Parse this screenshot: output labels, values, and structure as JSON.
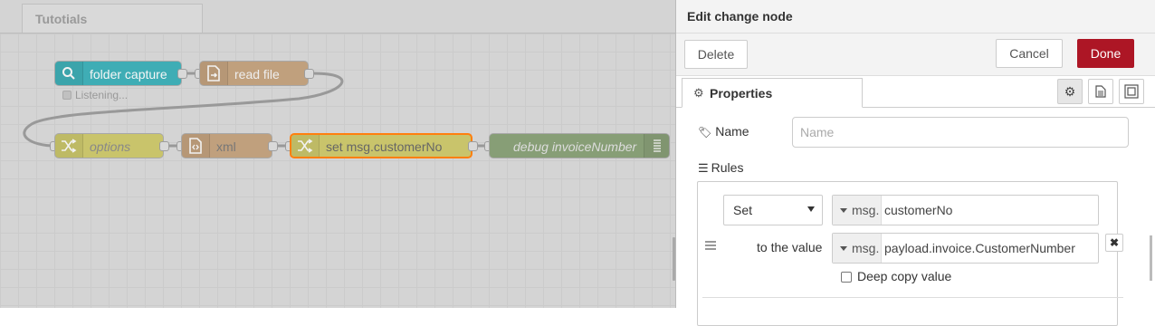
{
  "workspace": {
    "tab_label": "Tutotials",
    "nodes": [
      {
        "label": "folder capture",
        "icon": "search-icon",
        "color": "#3FADB5"
      },
      {
        "label": "read file",
        "icon": "file-in-icon",
        "color": "#C0A07D"
      },
      {
        "label": "options",
        "icon": "shuffle-icon",
        "color": "#C9C46B"
      },
      {
        "label": "xml",
        "icon": "file-code-icon",
        "color": "#C0A07D"
      },
      {
        "label": "set msg.customerNo",
        "icon": "shuffle-icon",
        "color": "#C9C46B"
      },
      {
        "label": "debug invoiceNumber",
        "icon": "list-icon",
        "color": "#879E76"
      }
    ],
    "status_text": "Listening..."
  },
  "tray": {
    "title": "Edit change node",
    "delete_label": "Delete",
    "cancel_label": "Cancel",
    "done_label": "Done",
    "properties_tab": "Properties",
    "name_label": "Name",
    "name_placeholder": "Name",
    "rules_label": "Rules",
    "rule": {
      "action": "Set",
      "target_type": "msg.",
      "target_value": "customerNo",
      "to_label": "to the value",
      "source_type": "msg.",
      "source_value": "payload.invoice.CustomerNumber",
      "deep_copy_label": "Deep copy value",
      "deep_copy": false
    }
  },
  "colors": {
    "primary_button": "#AD1625",
    "selected_node_border": "#FF7F0E"
  }
}
